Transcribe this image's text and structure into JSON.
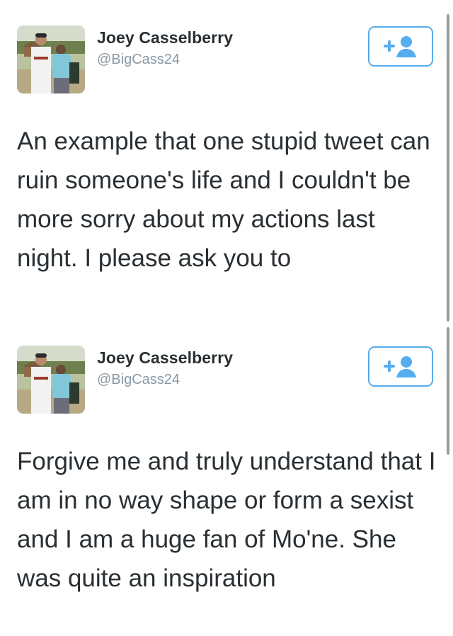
{
  "tweets": [
    {
      "author": {
        "name": "Joey Casselberry",
        "handle": "@BigCass24",
        "avatar": "avatar-photo-two-people"
      },
      "follow_icon": "follow-add-user-icon",
      "text": "An example that one stupid tweet can ruin someone's life and I couldn't be more sorry about my actions last night. I please ask you to"
    },
    {
      "author": {
        "name": "Joey Casselberry",
        "handle": "@BigCass24",
        "avatar": "avatar-photo-two-people"
      },
      "follow_icon": "follow-add-user-icon",
      "text": "Forgive me and truly understand that I am in no way shape or form a sexist and I am a huge fan of Mo'ne. She was quite an inspiration"
    }
  ],
  "colors": {
    "accent": "#55acee",
    "name": "#292f33",
    "handle": "#8899a6",
    "scrollbar": "#9a9a9a"
  }
}
